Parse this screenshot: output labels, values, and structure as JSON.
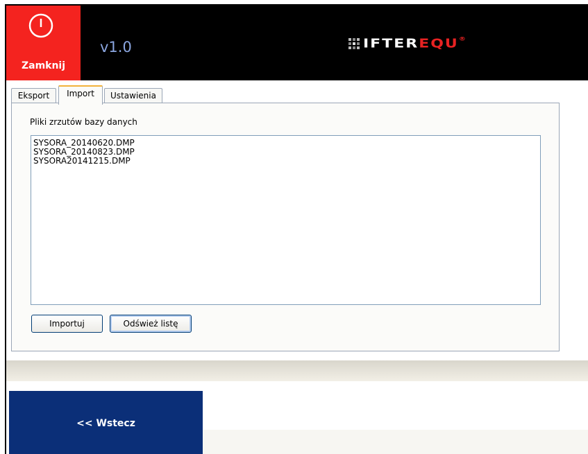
{
  "header": {
    "close_label": "Zamknij",
    "version": "v1.0",
    "logo_text_white": "IFTER",
    "logo_text_red": "EQU",
    "logo_reg": "®",
    "colors": {
      "close_bg": "#f4231f",
      "header_bg": "#000000",
      "version": "#8ba6e0",
      "logo_red": "#e82222"
    }
  },
  "tabs": [
    {
      "label": "Eksport",
      "active": false
    },
    {
      "label": "Import",
      "active": true
    },
    {
      "label": "Ustawienia",
      "active": false
    }
  ],
  "import_panel": {
    "label": "Pliki zrzutów bazy danych",
    "files": [
      "SYSORA_20140620.DMP",
      "SYSORA_20140823.DMP",
      "SYSORA20141215.DMP"
    ],
    "import_button": "Importuj",
    "refresh_button": "Odśwież listę"
  },
  "footer": {
    "back_button": "<< Wstecz",
    "back_bg": "#0b2f78"
  }
}
